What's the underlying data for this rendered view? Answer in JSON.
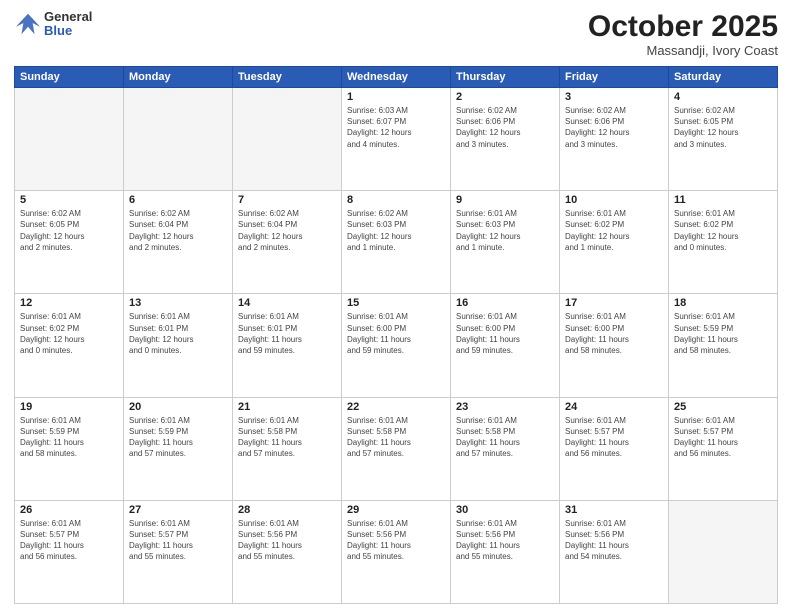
{
  "header": {
    "logo": {
      "general": "General",
      "blue": "Blue"
    },
    "month_title": "October 2025",
    "location": "Massandji, Ivory Coast"
  },
  "weekdays": [
    "Sunday",
    "Monday",
    "Tuesday",
    "Wednesday",
    "Thursday",
    "Friday",
    "Saturday"
  ],
  "weeks": [
    [
      {
        "day": "",
        "info": ""
      },
      {
        "day": "",
        "info": ""
      },
      {
        "day": "",
        "info": ""
      },
      {
        "day": "1",
        "info": "Sunrise: 6:03 AM\nSunset: 6:07 PM\nDaylight: 12 hours\nand 4 minutes."
      },
      {
        "day": "2",
        "info": "Sunrise: 6:02 AM\nSunset: 6:06 PM\nDaylight: 12 hours\nand 3 minutes."
      },
      {
        "day": "3",
        "info": "Sunrise: 6:02 AM\nSunset: 6:06 PM\nDaylight: 12 hours\nand 3 minutes."
      },
      {
        "day": "4",
        "info": "Sunrise: 6:02 AM\nSunset: 6:05 PM\nDaylight: 12 hours\nand 3 minutes."
      }
    ],
    [
      {
        "day": "5",
        "info": "Sunrise: 6:02 AM\nSunset: 6:05 PM\nDaylight: 12 hours\nand 2 minutes."
      },
      {
        "day": "6",
        "info": "Sunrise: 6:02 AM\nSunset: 6:04 PM\nDaylight: 12 hours\nand 2 minutes."
      },
      {
        "day": "7",
        "info": "Sunrise: 6:02 AM\nSunset: 6:04 PM\nDaylight: 12 hours\nand 2 minutes."
      },
      {
        "day": "8",
        "info": "Sunrise: 6:02 AM\nSunset: 6:03 PM\nDaylight: 12 hours\nand 1 minute."
      },
      {
        "day": "9",
        "info": "Sunrise: 6:01 AM\nSunset: 6:03 PM\nDaylight: 12 hours\nand 1 minute."
      },
      {
        "day": "10",
        "info": "Sunrise: 6:01 AM\nSunset: 6:02 PM\nDaylight: 12 hours\nand 1 minute."
      },
      {
        "day": "11",
        "info": "Sunrise: 6:01 AM\nSunset: 6:02 PM\nDaylight: 12 hours\nand 0 minutes."
      }
    ],
    [
      {
        "day": "12",
        "info": "Sunrise: 6:01 AM\nSunset: 6:02 PM\nDaylight: 12 hours\nand 0 minutes."
      },
      {
        "day": "13",
        "info": "Sunrise: 6:01 AM\nSunset: 6:01 PM\nDaylight: 12 hours\nand 0 minutes."
      },
      {
        "day": "14",
        "info": "Sunrise: 6:01 AM\nSunset: 6:01 PM\nDaylight: 11 hours\nand 59 minutes."
      },
      {
        "day": "15",
        "info": "Sunrise: 6:01 AM\nSunset: 6:00 PM\nDaylight: 11 hours\nand 59 minutes."
      },
      {
        "day": "16",
        "info": "Sunrise: 6:01 AM\nSunset: 6:00 PM\nDaylight: 11 hours\nand 59 minutes."
      },
      {
        "day": "17",
        "info": "Sunrise: 6:01 AM\nSunset: 6:00 PM\nDaylight: 11 hours\nand 58 minutes."
      },
      {
        "day": "18",
        "info": "Sunrise: 6:01 AM\nSunset: 5:59 PM\nDaylight: 11 hours\nand 58 minutes."
      }
    ],
    [
      {
        "day": "19",
        "info": "Sunrise: 6:01 AM\nSunset: 5:59 PM\nDaylight: 11 hours\nand 58 minutes."
      },
      {
        "day": "20",
        "info": "Sunrise: 6:01 AM\nSunset: 5:59 PM\nDaylight: 11 hours\nand 57 minutes."
      },
      {
        "day": "21",
        "info": "Sunrise: 6:01 AM\nSunset: 5:58 PM\nDaylight: 11 hours\nand 57 minutes."
      },
      {
        "day": "22",
        "info": "Sunrise: 6:01 AM\nSunset: 5:58 PM\nDaylight: 11 hours\nand 57 minutes."
      },
      {
        "day": "23",
        "info": "Sunrise: 6:01 AM\nSunset: 5:58 PM\nDaylight: 11 hours\nand 57 minutes."
      },
      {
        "day": "24",
        "info": "Sunrise: 6:01 AM\nSunset: 5:57 PM\nDaylight: 11 hours\nand 56 minutes."
      },
      {
        "day": "25",
        "info": "Sunrise: 6:01 AM\nSunset: 5:57 PM\nDaylight: 11 hours\nand 56 minutes."
      }
    ],
    [
      {
        "day": "26",
        "info": "Sunrise: 6:01 AM\nSunset: 5:57 PM\nDaylight: 11 hours\nand 56 minutes."
      },
      {
        "day": "27",
        "info": "Sunrise: 6:01 AM\nSunset: 5:57 PM\nDaylight: 11 hours\nand 55 minutes."
      },
      {
        "day": "28",
        "info": "Sunrise: 6:01 AM\nSunset: 5:56 PM\nDaylight: 11 hours\nand 55 minutes."
      },
      {
        "day": "29",
        "info": "Sunrise: 6:01 AM\nSunset: 5:56 PM\nDaylight: 11 hours\nand 55 minutes."
      },
      {
        "day": "30",
        "info": "Sunrise: 6:01 AM\nSunset: 5:56 PM\nDaylight: 11 hours\nand 55 minutes."
      },
      {
        "day": "31",
        "info": "Sunrise: 6:01 AM\nSunset: 5:56 PM\nDaylight: 11 hours\nand 54 minutes."
      },
      {
        "day": "",
        "info": ""
      }
    ]
  ]
}
